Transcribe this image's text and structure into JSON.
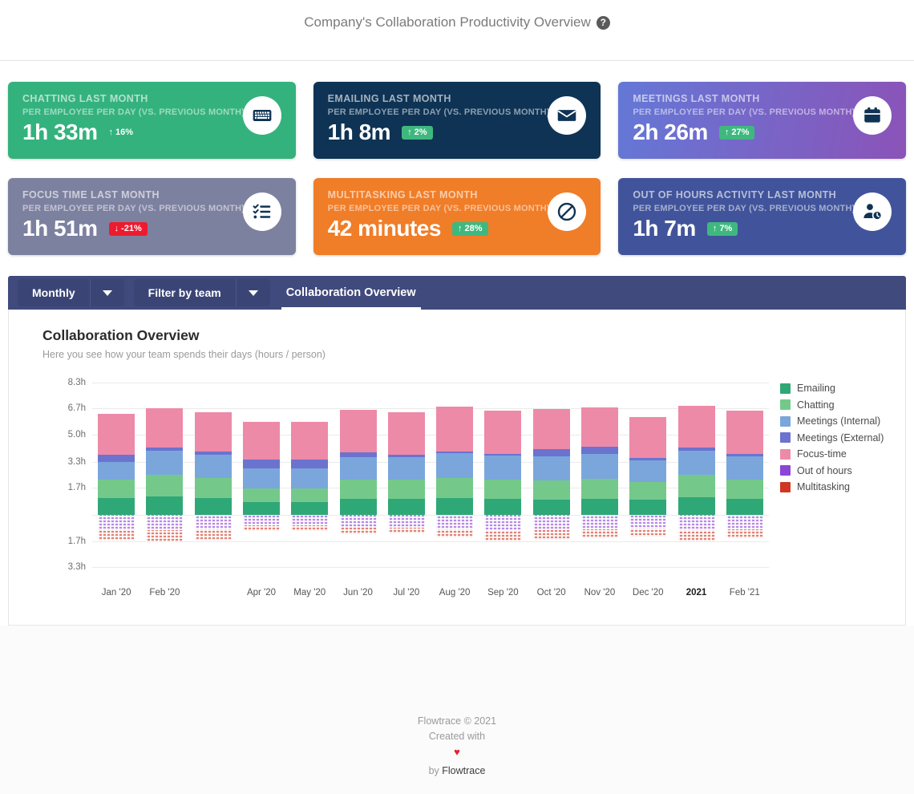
{
  "header": {
    "title": "Company's Collaboration Productivity Overview",
    "help_icon": "help-circle-icon",
    "help_glyph": "?"
  },
  "cards": [
    {
      "title": "CHATTING LAST MONTH",
      "subtitle": "PER EMPLOYEE PER DAY (VS. PREVIOUS MONTH)",
      "value": "1h 33m",
      "delta": "↑ 16%",
      "delta_dir": "up",
      "delta_style": "plain",
      "bg": "#34b27d",
      "icon": "keyboard-icon"
    },
    {
      "title": "EMAILING LAST MONTH",
      "subtitle": "PER EMPLOYEE PER DAY (VS. PREVIOUS MONTH)",
      "value": "1h 8m",
      "delta": "↑ 2%",
      "delta_dir": "up",
      "delta_style": "badge",
      "bg": "#0e3354",
      "icon": "envelope-icon"
    },
    {
      "title": "MEETINGS LAST MONTH",
      "subtitle": "PER EMPLOYEE PER DAY (VS. PREVIOUS MONTH)",
      "value": "2h 26m",
      "delta": "↑ 27%",
      "delta_dir": "up",
      "delta_style": "badge",
      "bg": "linear-gradient(100deg, #6478d6 0%, #8b53b8 100%)",
      "icon": "calendar-icon"
    },
    {
      "title": "FOCUS TIME LAST MONTH",
      "subtitle": "PER EMPLOYEE PER DAY (VS. PREVIOUS MONTH)",
      "value": "1h 51m",
      "delta": "↓ -21%",
      "delta_dir": "down",
      "delta_style": "badge",
      "bg": "#7d81a0",
      "icon": "checklist-icon"
    },
    {
      "title": "MULTITASKING LAST MONTH",
      "subtitle": "PER EMPLOYEE PER DAY (VS. PREVIOUS MONTH)",
      "value": "42 minutes",
      "delta": "↑ 28%",
      "delta_dir": "up",
      "delta_style": "badge",
      "bg": "#f07d28",
      "icon": "ban-icon"
    },
    {
      "title": "OUT OF HOURS ACTIVITY LAST MONTH",
      "subtitle": "PER EMPLOYEE PER DAY (VS. PREVIOUS MONTH)",
      "value": "1h 7m",
      "delta": "↑ 7%",
      "delta_dir": "up",
      "delta_style": "badge",
      "bg": "#41549b",
      "icon": "person-clock-icon"
    }
  ],
  "toolbar": {
    "period_label": "Monthly",
    "team_label": "Filter by team",
    "tabs": [
      {
        "label": "Collaboration Overview",
        "active": true
      }
    ]
  },
  "panel": {
    "title": "Collaboration Overview",
    "subtitle": "Here you see how your team spends their days (hours / person)"
  },
  "chart_data": {
    "type": "bar",
    "stacked": true,
    "title": "Collaboration Overview",
    "subtitle": "Here you see how your team spends their days (hours / person)",
    "xlabel": "",
    "ylabel": "",
    "ylim": [
      -4.2,
      8.3
    ],
    "grid": true,
    "legend_position": "right",
    "ytick_labels": [
      "8.3h",
      "6.7h",
      "5.0h",
      "3.3h",
      "1.7h",
      "",
      "1.7h",
      "3.3h"
    ],
    "ytick_values": [
      8.3,
      6.7,
      5.0,
      3.3,
      1.7,
      0,
      -1.7,
      -3.3
    ],
    "categories": [
      "Jan '20",
      "Feb '20",
      "",
      "Apr '20",
      "May '20",
      "Jun '20",
      "Jul '20",
      "Aug '20",
      "Sep '20",
      "Oct '20",
      "Nov '20",
      "Dec '20",
      "2021",
      "Feb '21"
    ],
    "bold_categories": [
      "2021"
    ],
    "series": [
      {
        "name": "Emailing",
        "color": "#2fa877",
        "sign": "positive",
        "values": [
          1.05,
          1.15,
          1.05,
          0.8,
          0.8,
          1.0,
          1.0,
          1.05,
          1.0,
          0.95,
          1.0,
          0.95,
          1.1,
          1.0
        ]
      },
      {
        "name": "Chatting",
        "color": "#74c98a",
        "sign": "positive",
        "values": [
          1.15,
          1.35,
          1.25,
          0.85,
          0.85,
          1.2,
          1.2,
          1.25,
          1.2,
          1.2,
          1.25,
          1.1,
          1.4,
          1.2
        ]
      },
      {
        "name": "Meetings (Internal)",
        "color": "#7aa6dc",
        "sign": "positive",
        "values": [
          1.1,
          1.5,
          1.45,
          1.25,
          1.25,
          1.4,
          1.4,
          1.55,
          1.5,
          1.5,
          1.55,
          1.35,
          1.5,
          1.45
        ]
      },
      {
        "name": "Meetings (External)",
        "color": "#6b73ce",
        "sign": "positive",
        "values": [
          0.45,
          0.2,
          0.2,
          0.55,
          0.55,
          0.3,
          0.15,
          0.1,
          0.1,
          0.45,
          0.45,
          0.15,
          0.2,
          0.15
        ]
      },
      {
        "name": "Focus-time",
        "color": "#ed8aa8",
        "sign": "positive",
        "values": [
          2.6,
          2.5,
          2.5,
          2.4,
          2.4,
          2.7,
          2.7,
          2.85,
          2.75,
          2.55,
          2.5,
          2.6,
          2.65,
          2.75
        ]
      },
      {
        "name": "Out of hours",
        "color": "#8e44d6",
        "sign": "negative",
        "values": [
          0.95,
          0.95,
          0.9,
          0.65,
          0.65,
          0.8,
          0.8,
          0.9,
          1.0,
          0.95,
          0.9,
          0.85,
          0.95,
          0.9
        ]
      },
      {
        "name": "Multitasking",
        "color": "#cf3723",
        "sign": "negative",
        "values": [
          0.7,
          0.8,
          0.75,
          0.35,
          0.35,
          0.45,
          0.4,
          0.55,
          0.7,
          0.65,
          0.6,
          0.55,
          0.75,
          0.6
        ]
      }
    ]
  },
  "footer": {
    "copyright": "Flowtrace © 2021",
    "created_with": "Created with",
    "heart": "♥",
    "by_prefix": "by ",
    "by_brand": "Flowtrace"
  }
}
